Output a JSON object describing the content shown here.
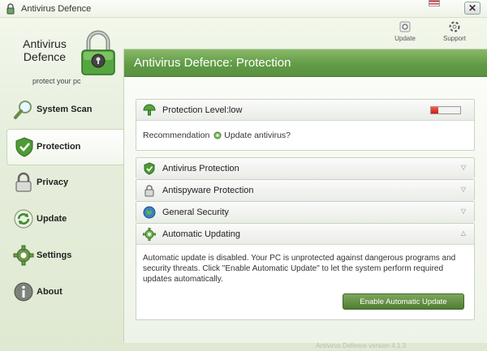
{
  "window": {
    "title": "Antivirus Defence",
    "close_label": "✕"
  },
  "brand": {
    "name": "Antivirus Defence",
    "tagline": "protect your pc"
  },
  "toolbar": {
    "update_label": "Update",
    "support_label": "Support"
  },
  "nav": {
    "items": [
      {
        "label": "System Scan",
        "icon": "magnifier-icon",
        "active": false
      },
      {
        "label": "Protection",
        "icon": "shield-icon",
        "active": true
      },
      {
        "label": "Privacy",
        "icon": "padlock-icon",
        "active": false
      },
      {
        "label": "Update",
        "icon": "update-arrows-icon",
        "active": false
      },
      {
        "label": "Settings",
        "icon": "gear-icon",
        "active": false
      },
      {
        "label": "About",
        "icon": "info-icon",
        "active": false
      }
    ]
  },
  "main": {
    "header_title": "Antivirus Defence: Protection",
    "protection_level_label": "Protection Level:low",
    "protection_level_fraction": 0.25,
    "recommendation_label": "Recommendation",
    "recommendation_link": "Update antivirus?",
    "panels": [
      {
        "label": "Antivirus Protection",
        "icon": "shield-check-icon"
      },
      {
        "label": "Antispyware Protection",
        "icon": "padlock-icon"
      },
      {
        "label": "General Security",
        "icon": "globe-icon"
      },
      {
        "label": "Automatic Updating",
        "icon": "gear-update-icon"
      }
    ],
    "update_message": "Automatic update is disabled. Your PC is unprotected against dangerous programs and security threats. Click \"Enable Automatic Update\" to let the system perform required updates automatically.",
    "enable_button_label": "Enable Automatic Update"
  },
  "footer": {
    "version": "Antivirus Defence version 4.1.3"
  },
  "colors": {
    "accent_green": "#5f9a44",
    "danger_red": "#c81e12"
  }
}
